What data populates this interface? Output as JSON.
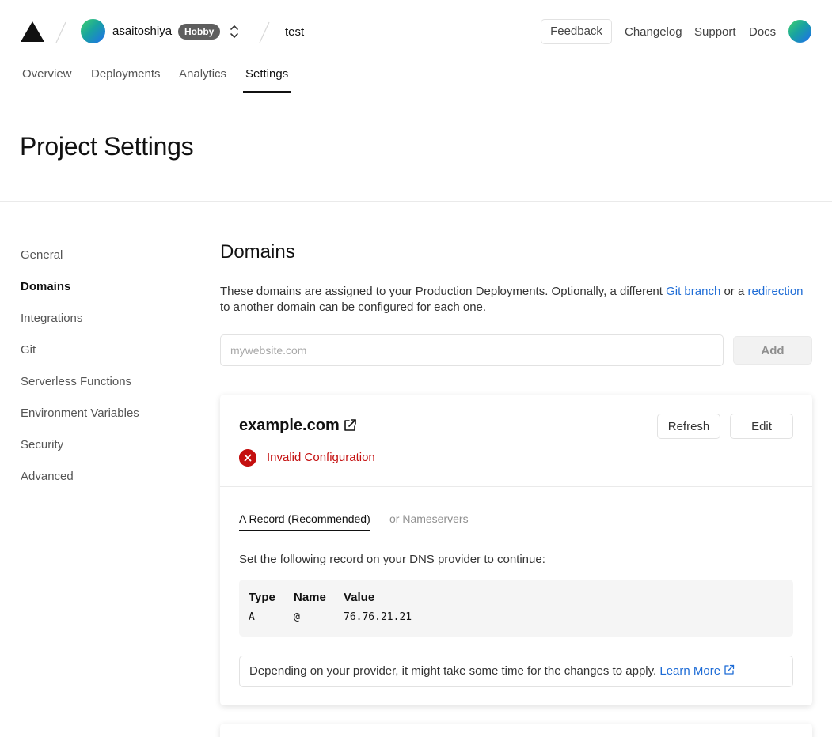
{
  "header": {
    "team_name": "asaitoshiya",
    "plan_badge": "Hobby",
    "project_name": "test",
    "feedback_label": "Feedback",
    "links": {
      "changelog": "Changelog",
      "support": "Support",
      "docs": "Docs"
    },
    "tabs": {
      "overview": "Overview",
      "deployments": "Deployments",
      "analytics": "Analytics",
      "settings": "Settings"
    },
    "active_tab": "Settings"
  },
  "page": {
    "title": "Project Settings"
  },
  "sidebar": {
    "items": [
      {
        "label": "General"
      },
      {
        "label": "Domains",
        "active": true
      },
      {
        "label": "Integrations"
      },
      {
        "label": "Git"
      },
      {
        "label": "Serverless Functions"
      },
      {
        "label": "Environment Variables"
      },
      {
        "label": "Security"
      },
      {
        "label": "Advanced"
      }
    ]
  },
  "domains": {
    "title": "Domains",
    "description_1": "These domains are assigned to your Production Deployments. Optionally, a different ",
    "git_branch_link": "Git branch",
    "description_2": " or a ",
    "redirection_link": "redirection",
    "description_3": " to another domain can be configured for each one.",
    "input_placeholder": "mywebsite.com",
    "input_value": "",
    "add_label": "Add",
    "card": {
      "domain": "example.com",
      "refresh_label": "Refresh",
      "edit_label": "Edit",
      "status": "Invalid Configuration",
      "tabs": {
        "a_record": "A Record (Recommended)",
        "nameservers": "or Nameservers"
      },
      "active_tab": "A Record (Recommended)",
      "instruction": "Set the following record on your DNS provider to continue:",
      "record_headers": {
        "type": "Type",
        "name": "Name",
        "value": "Value"
      },
      "record": {
        "type": "A",
        "name": "@",
        "value": "76.76.21.21"
      },
      "note": "Depending on your provider, it might take some time for the changes to apply.",
      "learn_more": "Learn More"
    }
  },
  "colors": {
    "accent_link": "#1e6cd6",
    "error": "#c40f0f",
    "badge_bg": "#5e5e5e",
    "text": "#111111"
  },
  "icons": {
    "logo": "triangle-logo-icon",
    "switcher": "chevron-up-down-icon",
    "external": "external-link-icon",
    "status": "error-x-icon"
  }
}
